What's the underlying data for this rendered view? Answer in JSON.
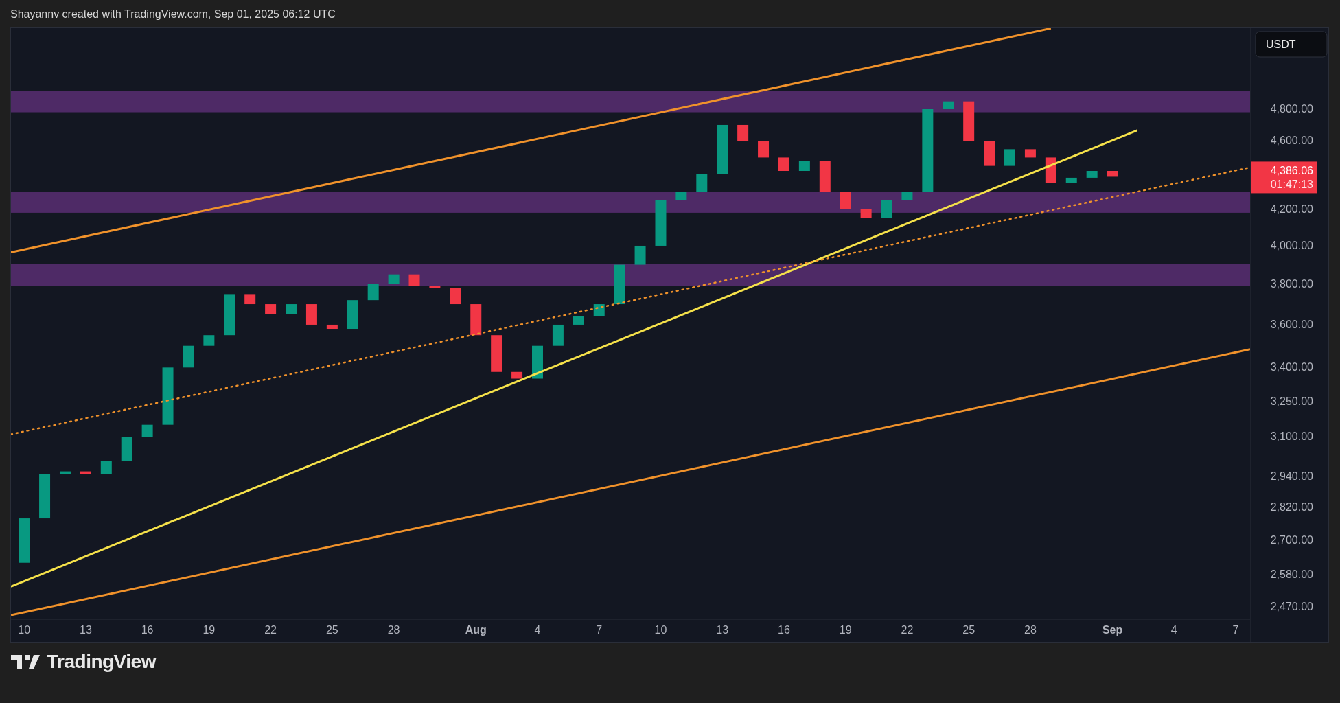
{
  "header": {
    "caption": "Shayannv created with TradingView.com, Sep 01, 2025 06:12 UTC"
  },
  "chart": {
    "currency_button": "USDT",
    "last_price": {
      "value": "4,386.06",
      "countdown": "01:47:13"
    },
    "price_axis": [
      "4,800.00",
      "4,600.00",
      "4,200.00",
      "4,000.00",
      "3,800.00",
      "3,600.00",
      "3,400.00",
      "3,250.00",
      "3,100.00",
      "2,940.00",
      "2,820.00",
      "2,700.00",
      "2,580.00",
      "2,470.00"
    ],
    "time_axis": [
      "10",
      "13",
      "16",
      "19",
      "22",
      "25",
      "28",
      "Aug",
      "4",
      "7",
      "10",
      "13",
      "16",
      "19",
      "22",
      "25",
      "28",
      "Sep",
      "4",
      "7"
    ]
  },
  "footer": {
    "logo_text": "TradingView"
  }
}
